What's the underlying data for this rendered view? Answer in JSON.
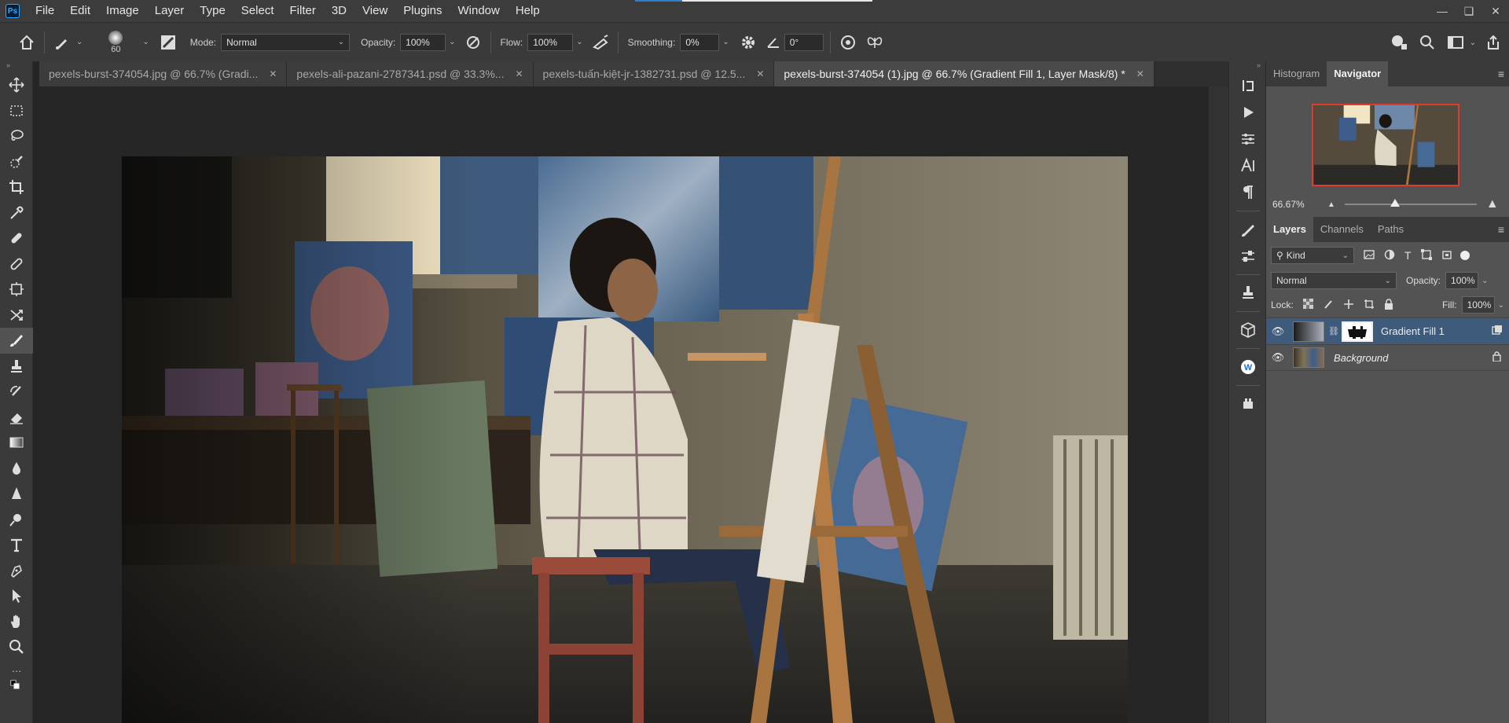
{
  "app": {
    "logo": "Ps",
    "menu": [
      "File",
      "Edit",
      "Image",
      "Layer",
      "Type",
      "Select",
      "Filter",
      "3D",
      "View",
      "Plugins",
      "Window",
      "Help"
    ],
    "window_controls": [
      "minimize-icon",
      "restore-icon",
      "close-icon"
    ]
  },
  "options": {
    "brush_size": "60",
    "mode_label": "Mode:",
    "mode_value": "Normal",
    "opacity_label": "Opacity:",
    "opacity_value": "100%",
    "flow_label": "Flow:",
    "flow_value": "100%",
    "smoothing_label": "Smoothing:",
    "smoothing_value": "0%",
    "angle_value": "0°"
  },
  "tabs": [
    {
      "label": "pexels-burst-374054.jpg @ 66.7% (Gradi...",
      "active": false
    },
    {
      "label": "pexels-ali-pazani-2787341.psd @ 33.3%...",
      "active": false
    },
    {
      "label": "pexels-tuấn-kiệt-jr-1382731.psd @ 12.5...",
      "active": false
    },
    {
      "label": "pexels-burst-374054 (1).jpg @ 66.7% (Gradient Fill 1, Layer Mask/8) *",
      "active": true
    }
  ],
  "panels": {
    "top_tabs": [
      "Histogram",
      "Navigator"
    ],
    "zoom": "66.67%",
    "layer_tabs": [
      "Layers",
      "Channels",
      "Paths"
    ],
    "filter_kind": "Kind",
    "blend_mode": "Normal",
    "opacity_label": "Opacity:",
    "opacity_value": "100%",
    "lock_label": "Lock:",
    "fill_label": "Fill:",
    "fill_value": "100%",
    "layers": [
      {
        "name": "Gradient Fill 1",
        "selected": true
      },
      {
        "name": "Background",
        "selected": false,
        "locked": true
      }
    ]
  },
  "colors": {
    "accent": "#31a8ff",
    "selection": "#3f5b7c",
    "navigator_frame": "#e03b2e"
  }
}
